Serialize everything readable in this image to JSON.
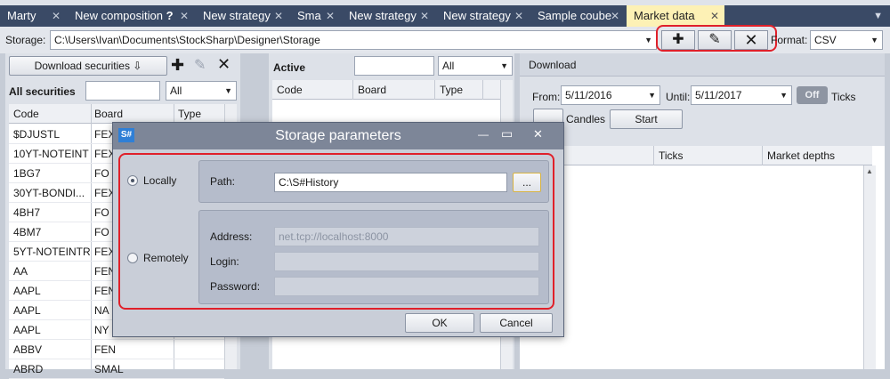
{
  "tabs": [
    {
      "label": "Marty"
    },
    {
      "label": "New composition",
      "extra": "?"
    },
    {
      "label": "New strategy"
    },
    {
      "label": "Sma"
    },
    {
      "label": "New strategy"
    },
    {
      "label": "New strategy"
    },
    {
      "label": "Sample coube"
    },
    {
      "label": "Market data",
      "active": true
    }
  ],
  "tab_close_glyph": "✕",
  "tab_overflow_glyph": "▼",
  "storage": {
    "label": "Storage:",
    "path": "C:\\Users\\Ivan\\Documents\\StockSharp\\Designer\\Storage",
    "format_label": "Format:",
    "format_value": "CSV",
    "add_icon": "plus-icon",
    "edit_icon": "pencil-icon",
    "delete_icon": "x-icon",
    "highlight_color": "#e0202a"
  },
  "left": {
    "download_label": "Download securities",
    "all_securities_label": "All securities",
    "filter_value": "All",
    "columns": [
      "Code",
      "Board",
      "Type"
    ],
    "rows": [
      {
        "code": "$DJUSTL",
        "board": "FEX"
      },
      {
        "code": "10YT-NOTEINT",
        "board": "FEX"
      },
      {
        "code": "1BG7",
        "board": "FO"
      },
      {
        "code": "30YT-BONDI...",
        "board": "FEX"
      },
      {
        "code": "4BH7",
        "board": "FO"
      },
      {
        "code": "4BM7",
        "board": "FO"
      },
      {
        "code": "5YT-NOTEINTR",
        "board": "FEX"
      },
      {
        "code": "AA",
        "board": "FEN"
      },
      {
        "code": "AAPL",
        "board": "FEN"
      },
      {
        "code": "AAPL",
        "board": "NA"
      },
      {
        "code": "AAPL",
        "board": "NY"
      },
      {
        "code": "ABBV",
        "board": "FEN"
      },
      {
        "code": "ABRD",
        "board": "SMAL"
      }
    ]
  },
  "middle": {
    "active_label": "Active",
    "filter_value": "All",
    "columns": [
      "Code",
      "Board",
      "Type"
    ]
  },
  "right": {
    "header": "Download",
    "from_label": "From:",
    "from_value": "5/11/2016",
    "until_label": "Until:",
    "until_value": "5/11/2017",
    "toggle_label": "Off",
    "ticks_label": "Ticks",
    "candles_label": "Candles",
    "start_label": "Start",
    "columns": [
      "Ticks",
      "Market depths"
    ]
  },
  "dialog": {
    "logo": "S#",
    "title": "Storage parameters",
    "minimize_glyph": "—",
    "maximize_glyph": "▭",
    "close_glyph": "✕",
    "locally_label": "Locally",
    "path_label": "Path:",
    "path_value": "C:\\S#History",
    "browse_label": "...",
    "remotely_label": "Remotely",
    "address_label": "Address:",
    "address_placeholder": "net.tcp://localhost:8000",
    "login_label": "Login:",
    "password_label": "Password:",
    "ok_label": "OK",
    "cancel_label": "Cancel",
    "selected_mode": "Locally"
  }
}
